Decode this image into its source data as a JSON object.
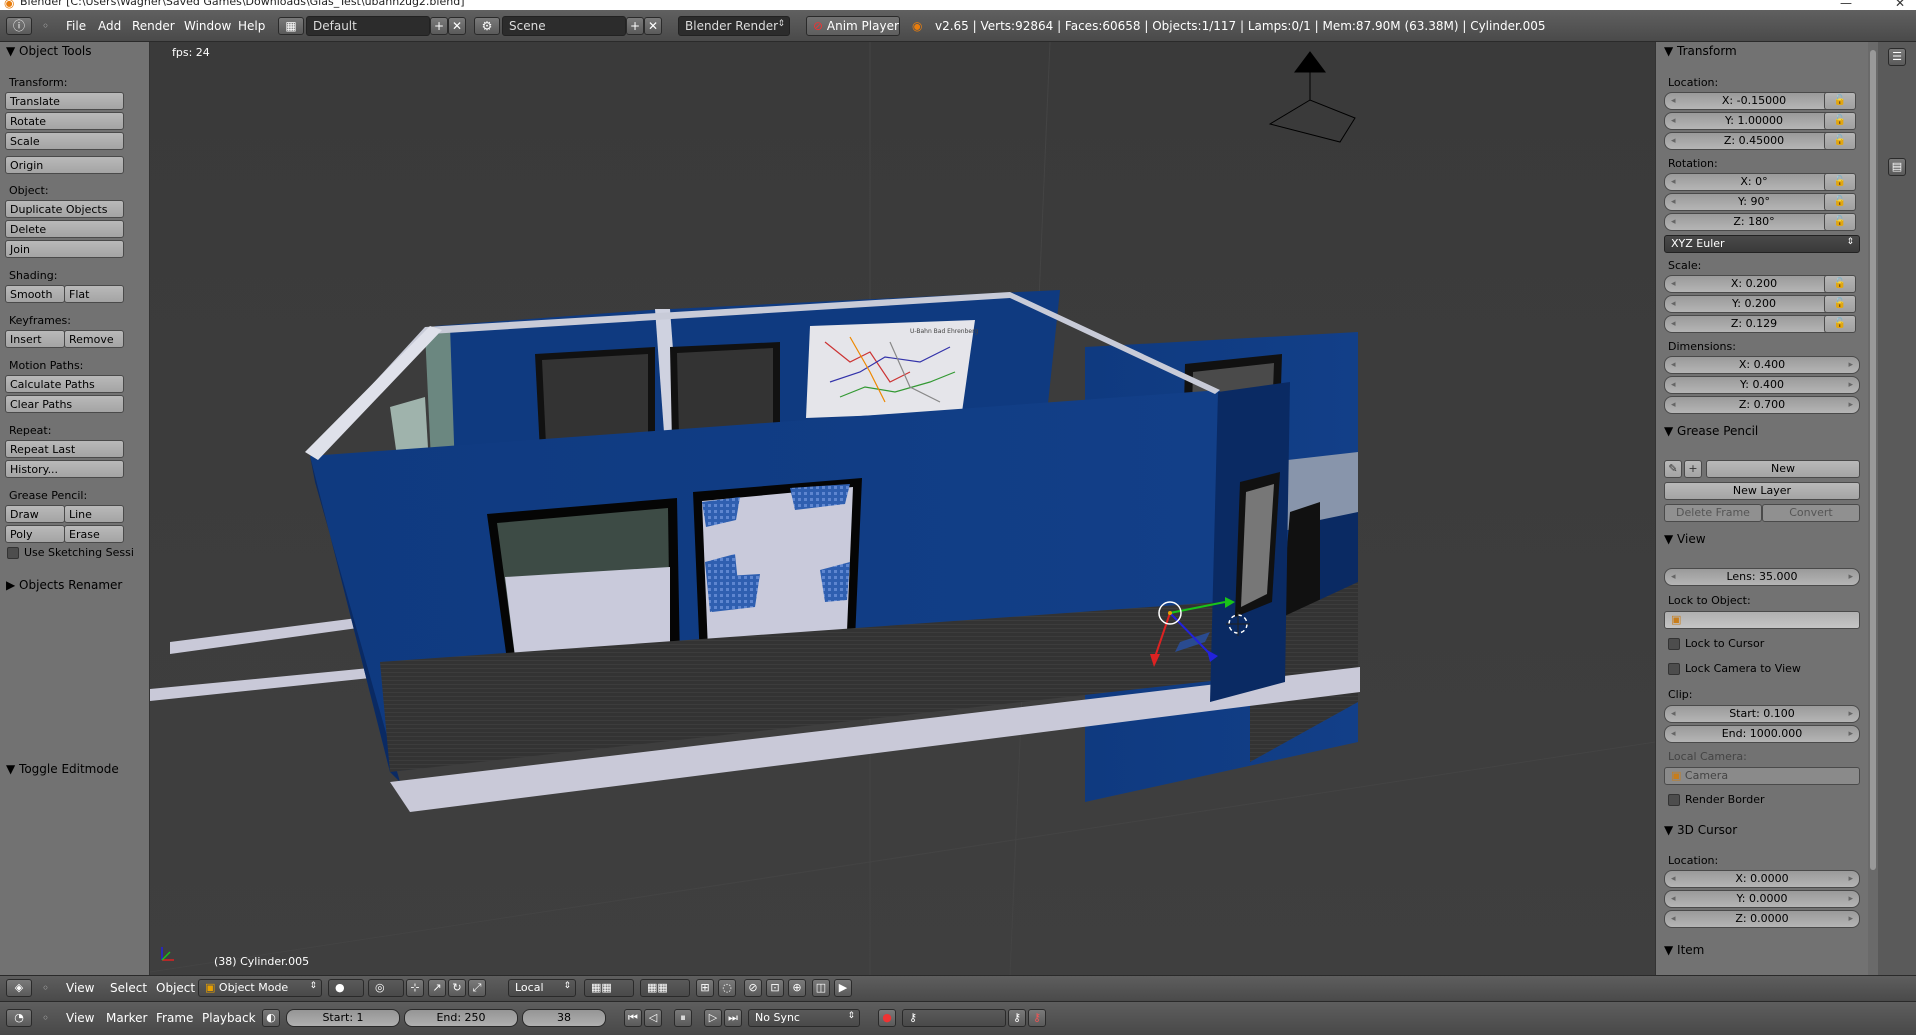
{
  "window": {
    "title": "Blender  [C:\\Users\\Wagner\\Saved Games\\Downloads\\Glas_Test\\ubahnzug2.blend]"
  },
  "info_header": {
    "menus": [
      "File",
      "Add",
      "Render",
      "Window",
      "Help"
    ],
    "screen_layout": "Default",
    "scene": "Scene",
    "render_engine": "Blender Render",
    "anim_player": "Anim Player",
    "stats": "v2.65 | Verts:92864 | Faces:60658 | Objects:1/117 | Lamps:0/1 | Mem:87.90M (63.38M) | Cylinder.005"
  },
  "tool_shelf": {
    "title": "Object Tools",
    "transform_label": "Transform:",
    "translate": "Translate",
    "rotate": "Rotate",
    "scale": "Scale",
    "origin": "Origin",
    "object_label": "Object:",
    "duplicate": "Duplicate Objects",
    "delete": "Delete",
    "join": "Join",
    "shading_label": "Shading:",
    "smooth": "Smooth",
    "flat": "Flat",
    "keyframes_label": "Keyframes:",
    "insert": "Insert",
    "remove": "Remove",
    "motion_paths_label": "Motion Paths:",
    "calculate_paths": "Calculate Paths",
    "clear_paths": "Clear Paths",
    "repeat_label": "Repeat:",
    "repeat_last": "Repeat Last",
    "history": "History...",
    "grease_pencil_label": "Grease Pencil:",
    "draw": "Draw",
    "line": "Line",
    "poly": "Poly",
    "erase": "Erase",
    "use_sketching": "Use Sketching Sessi",
    "objects_renamer": "Objects Renamer",
    "toggle_editmode": "Toggle Editmode"
  },
  "viewport": {
    "fps": "fps: 24",
    "object_info": "(38) Cylinder.005",
    "map_title": "U-Bahn Bad Ehrenberg"
  },
  "properties": {
    "transform_title": "Transform",
    "location_label": "Location:",
    "loc_x": "X: -0.15000",
    "loc_y": "Y: 1.00000",
    "loc_z": "Z: 0.45000",
    "rotation_label": "Rotation:",
    "rot_x": "X: 0°",
    "rot_y": "Y: 90°",
    "rot_z": "Z: 180°",
    "rotation_mode": "XYZ Euler",
    "scale_label": "Scale:",
    "scale_x": "X: 0.200",
    "scale_y": "Y: 0.200",
    "scale_z": "Z: 0.129",
    "dimensions_label": "Dimensions:",
    "dim_x": "X: 0.400",
    "dim_y": "Y: 0.400",
    "dim_z": "Z: 0.700",
    "grease_pencil_title": "Grease Pencil",
    "gp_new": "New",
    "gp_new_layer": "New Layer",
    "gp_delete_frame": "Delete Frame",
    "gp_convert": "Convert",
    "view_title": "View",
    "lens": "Lens: 35.000",
    "lock_to_object_label": "Lock to Object:",
    "lock_to_cursor": "Lock to Cursor",
    "lock_camera_to_view": "Lock Camera to View",
    "clip_label": "Clip:",
    "clip_start": "Start: 0.100",
    "clip_end": "End: 1000.000",
    "local_camera_label": "Local Camera:",
    "camera": "Camera",
    "render_border": "Render Border",
    "cursor_title": "3D Cursor",
    "cursor_location_label": "Location:",
    "cursor_x": "X: 0.0000",
    "cursor_y": "Y: 0.0000",
    "cursor_z": "Z: 0.0000",
    "item_title": "Item"
  },
  "view_header": {
    "view": "View",
    "select": "Select",
    "object": "Object",
    "mode": "Object Mode",
    "orientation": "Local"
  },
  "timeline": {
    "view": "View",
    "marker": "Marker",
    "frame": "Frame",
    "playback": "Playback",
    "start": "Start: 1",
    "end": "End: 250",
    "current": "38",
    "sync": "No Sync"
  },
  "colors": {
    "train_blue": "#0f3a80",
    "train_blue_dark": "#0a2a63",
    "panel_gray": "#727272",
    "viewport_bg": "#3b3b3b",
    "seat_blue": "#2f5fb0"
  }
}
